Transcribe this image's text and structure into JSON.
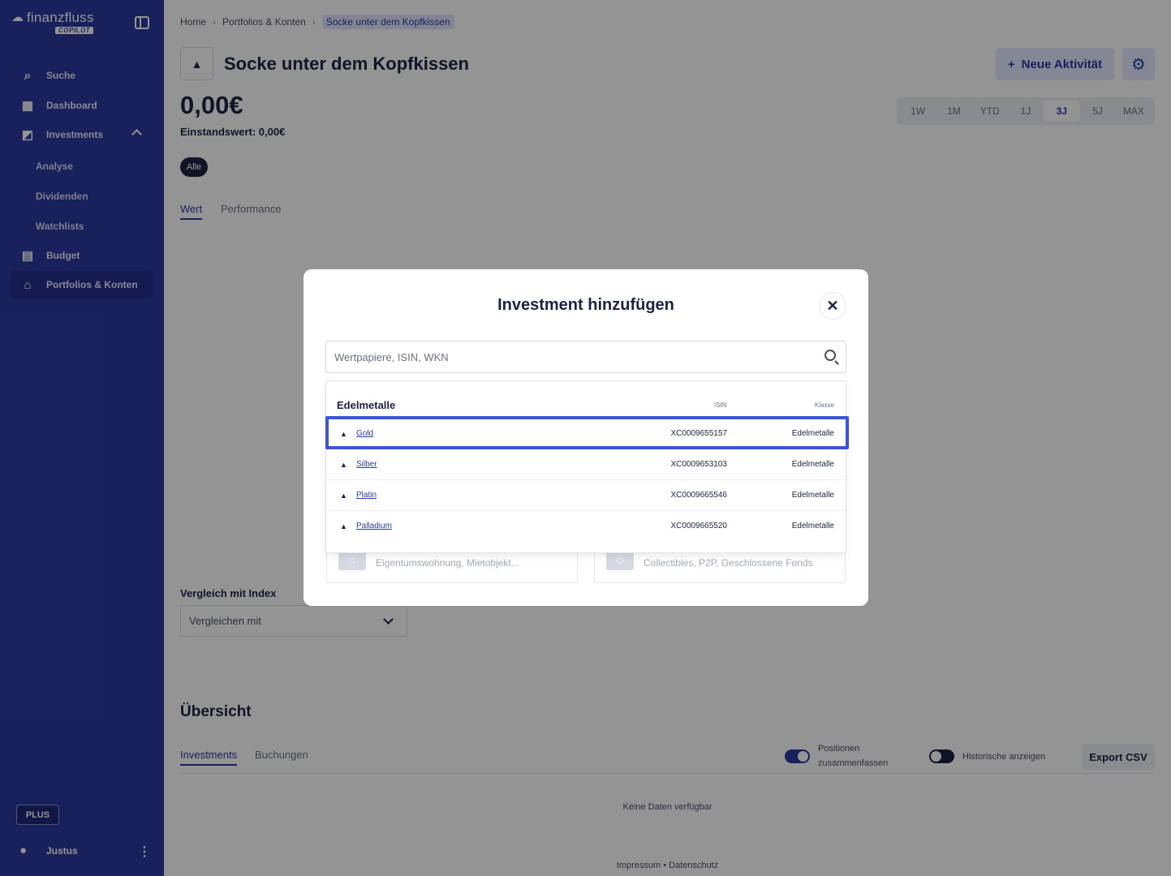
{
  "sidebar": {
    "brand": "finanzfluss",
    "copilot_badge": "COPILOT",
    "items": [
      {
        "label": "Suche",
        "icon": "search-icon"
      },
      {
        "label": "Dashboard",
        "icon": "dashboard-icon"
      },
      {
        "label": "Investments",
        "icon": "chart-icon"
      },
      {
        "label": "Budget",
        "icon": "budget-icon"
      },
      {
        "label": "Portfolios & Konten",
        "icon": "bank-icon"
      }
    ],
    "sub_items": [
      "Analyse",
      "Dividenden",
      "Watchlists"
    ],
    "plus_label": "PLUS",
    "user_name": "Justus"
  },
  "breadcrumb": [
    "Home",
    "Portfolios & Konten",
    "Socke unter dem Kopfkissen"
  ],
  "page": {
    "title": "Socke unter dem Kopfkissen",
    "new_activity_label": "Neue Aktivität",
    "value": "0,00€",
    "einstand": "Einstandswert: 0,00€",
    "filter_pill": "Alle",
    "tabs": [
      "Wert",
      "Performance"
    ],
    "ranges": [
      "1W",
      "1M",
      "YTD",
      "1J",
      "3J",
      "5J",
      "MAX"
    ],
    "selected_range": "3J",
    "compare_label": "Vergleich mit Index",
    "compare_placeholder": "Vergleichen mit",
    "overview_title": "Übersicht",
    "overview_tabs": [
      "Investments",
      "Buchungen"
    ],
    "toggle_positions_line1": "Positionen",
    "toggle_positions_line2": "zusammenfassen",
    "toggle_history": "Historische anzeigen",
    "export_label": "Export CSV",
    "no_data": "Keine Daten verfügbar",
    "footer": "Impressum  •  Datenschutz"
  },
  "modal": {
    "title": "Investment hinzufügen",
    "search_placeholder": "Wertpapiere, ISIN, WKN",
    "category": "Edelmetalle",
    "col_isin": "ISIN",
    "col_class": "Klasse",
    "rows": [
      {
        "name": "Gold",
        "isin": "XC0009655157",
        "class": "Edelmetalle"
      },
      {
        "name": "Silber",
        "isin": "XC0009653103",
        "class": "Edelmetalle"
      },
      {
        "name": "Platin",
        "isin": "XC0009665546",
        "class": "Edelmetalle"
      },
      {
        "name": "Palladium",
        "isin": "XC0009665520",
        "class": "Edelmetalle"
      }
    ],
    "bg_card_left": "Eigentumswohnung, Mietobjekt...",
    "bg_card_right": "Collectibles, P2P, Geschlossene Fonds"
  },
  "colors": {
    "sidebar": "#2b3aa0",
    "accent": "#2b3aa0",
    "highlight": "#3a55d6"
  }
}
